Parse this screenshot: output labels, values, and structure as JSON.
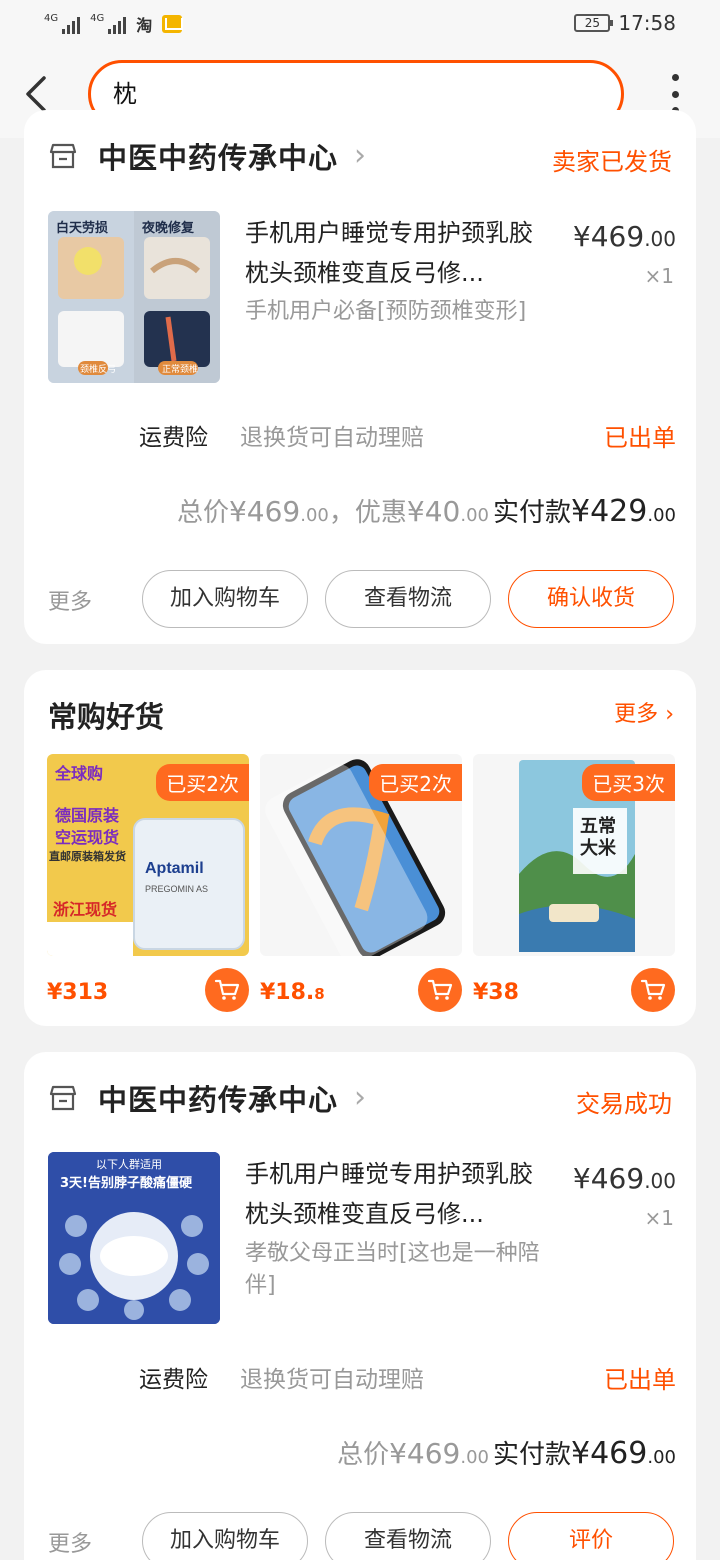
{
  "status_bar": {
    "net1": "4G",
    "net2": "4G",
    "taobao": "淘",
    "battery": "25",
    "time": "17:58"
  },
  "search": {
    "query": "枕"
  },
  "orders": [
    {
      "shop": "中医中药传承中心",
      "status": "卖家已发货",
      "title": "手机用户睡觉专用护颈乳胶枕头颈椎变直反弓修...",
      "subtitle": "手机用户必备[预防颈椎变形]",
      "price_int": "¥469",
      "price_dec": ".00",
      "qty": "×1",
      "insurance_label": "运费险",
      "insurance_desc": "退换货可自动理赔",
      "insurance_state": "已出单",
      "total_label": "总价",
      "total_int": "¥469",
      "total_dec": ".00",
      "discount_label": "，优惠",
      "discount_int": "¥40",
      "discount_dec": ".00",
      "paid_label": "实付款",
      "paid_int": "¥429",
      "paid_dec": ".00",
      "more": "更多",
      "btn1": "加入购物车",
      "btn2": "查看物流",
      "btn3": "确认收货",
      "image_text": {
        "left_top": "白天劳损",
        "right_top": "夜晚修复",
        "left_bottom": "颈椎反弓",
        "right_bottom": "正常颈椎"
      }
    },
    {
      "shop": "中医中药传承中心",
      "status": "交易成功",
      "title": "手机用户睡觉专用护颈乳胶枕头颈椎变直反弓修...",
      "subtitle": "孝敬父母正当时[这也是一种陪伴]",
      "price_int": "¥469",
      "price_dec": ".00",
      "qty": "×1",
      "insurance_label": "运费险",
      "insurance_desc": "退换货可自动理赔",
      "insurance_state": "已出单",
      "total_label": "总价",
      "total_int": "¥469",
      "total_dec": ".00",
      "paid_label": "实付款",
      "paid_int": "¥469",
      "paid_dec": ".00",
      "more": "更多",
      "btn1": "加入购物车",
      "btn2": "查看物流",
      "btn3": "评价",
      "image_text": {
        "top": "以下人群适用",
        "headline": "3天!告别脖子酸痛僵硬"
      }
    }
  ],
  "recommend": {
    "title": "常购好货",
    "more": "更多",
    "items": [
      {
        "badge": "已买2次",
        "price_int": "¥313",
        "price_dec": "",
        "img_top": "全球购",
        "img_lines": [
          "德国原装",
          "空运现货",
          "直邮原装箱发货"
        ],
        "img_brand": "Aptamil",
        "img_sub": "PREGOMIN AS",
        "img_bottom": "浙江现货"
      },
      {
        "badge": "已买2次",
        "price_int": "¥18.",
        "price_dec": "8"
      },
      {
        "badge": "已买3次",
        "price_int": "¥38",
        "price_dec": "",
        "img_text": "五常大米"
      }
    ]
  },
  "colors": {
    "accent": "#ff5000",
    "badge": "#ff6a1f"
  }
}
